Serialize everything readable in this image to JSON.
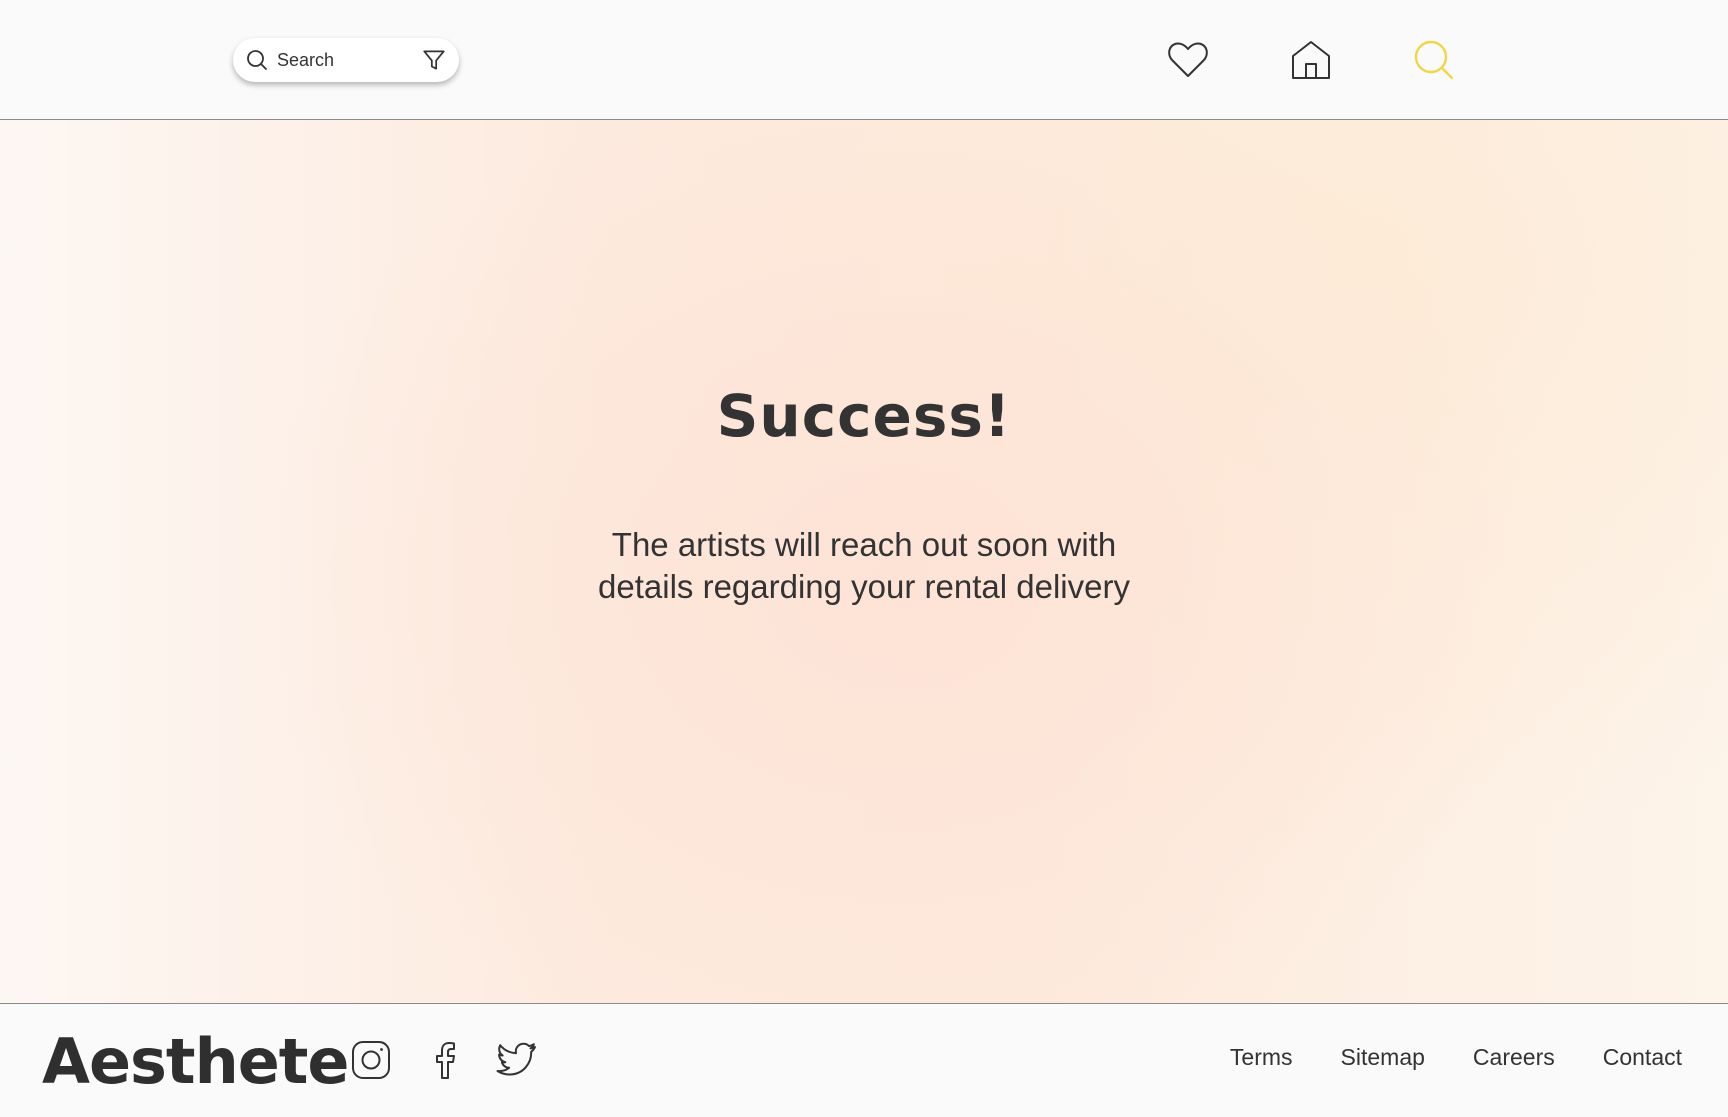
{
  "header": {
    "search": {
      "label": "Search",
      "icon": "search-icon",
      "filter_icon": "filter-icon"
    },
    "nav": [
      {
        "name": "favorites",
        "icon": "heart-icon"
      },
      {
        "name": "home",
        "icon": "home-icon"
      },
      {
        "name": "search",
        "icon": "search-icon",
        "active": true
      }
    ],
    "active_color": "#f2d649"
  },
  "main": {
    "title": "Success!",
    "message": "The artists will reach out soon with details regarding your rental delivery"
  },
  "footer": {
    "brand": "Aesthete",
    "social": [
      {
        "name": "instagram",
        "icon": "instagram-icon"
      },
      {
        "name": "facebook",
        "icon": "facebook-icon"
      },
      {
        "name": "twitter",
        "icon": "twitter-icon"
      }
    ],
    "links": [
      "Terms",
      "Sitemap",
      "Careers",
      "Contact"
    ]
  },
  "colors": {
    "text": "#333333",
    "divider": "#8a8a8a",
    "background_gradient": [
      "#fdf7f3",
      "#fde3d6",
      "#fdf4ea"
    ]
  }
}
